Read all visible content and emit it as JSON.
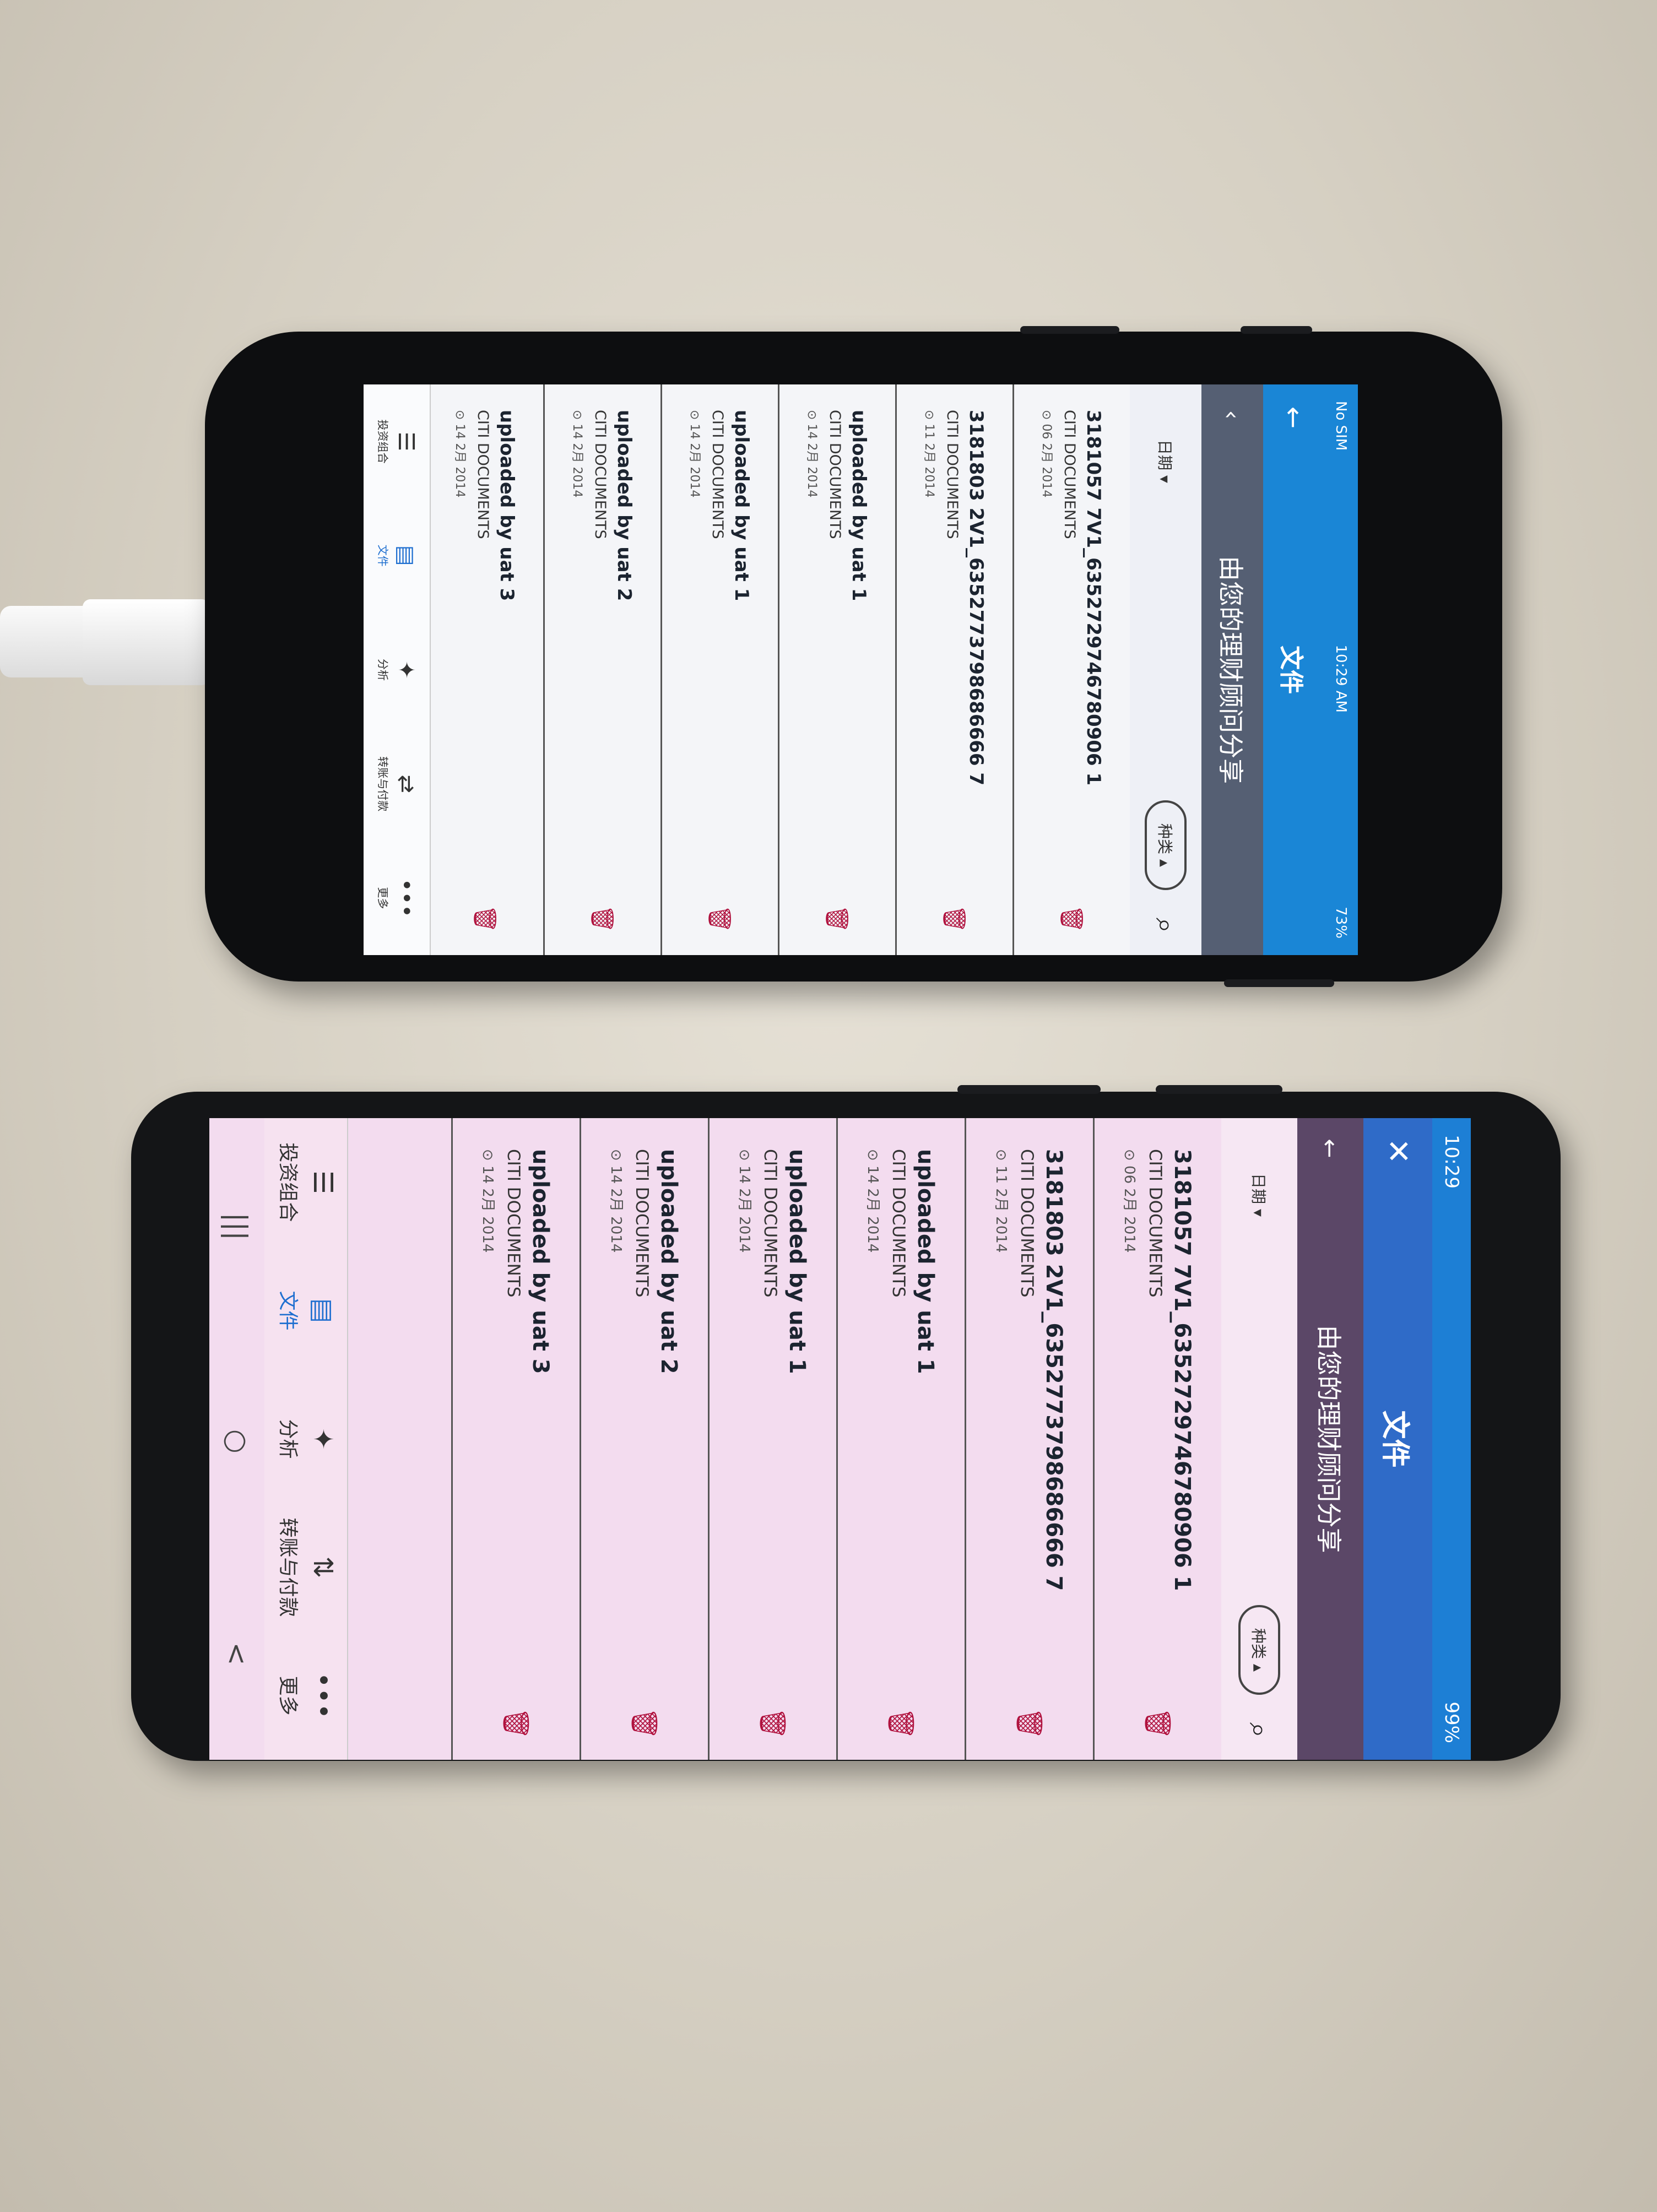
{
  "top_phone": {
    "status": {
      "carrier": "No SIM",
      "time": "10:29 AM",
      "battery": "73%"
    },
    "appbar": {
      "title": "文件"
    },
    "subbar": {
      "text": "由您的理财顾问分享"
    },
    "filters": {
      "date": "日期 ▾",
      "type": "种类 ▴"
    },
    "files": [
      {
        "name": "3181057 7V1_6352729746780906 1",
        "source": "CITI DOCUMENTS",
        "date": "⊙ 06 2月 2014"
      },
      {
        "name": "3181803 2V1_6352773798686666 7",
        "source": "CITI DOCUMENTS",
        "date": "⊙ 11 2月 2014"
      },
      {
        "name": "uploaded by uat 1",
        "source": "CITI DOCUMENTS",
        "date": "⊙ 14 2月 2014"
      },
      {
        "name": "uploaded by uat 1",
        "source": "CITI DOCUMENTS",
        "date": "⊙ 14 2月 2014"
      },
      {
        "name": "uploaded by uat 2",
        "source": "CITI DOCUMENTS",
        "date": "⊙ 14 2月 2014"
      },
      {
        "name": "uploaded by uat 3",
        "source": "CITI DOCUMENTS",
        "date": "⊙ 14 2月 2014"
      }
    ],
    "tabs": [
      {
        "label": "投资组合",
        "icon": "portfolio-icon",
        "glyph": "☰"
      },
      {
        "label": "文件",
        "icon": "document-icon",
        "glyph": "▤"
      },
      {
        "label": "分析",
        "icon": "lightbulb-icon",
        "glyph": "✦"
      },
      {
        "label": "转账与付款",
        "icon": "transfer-icon",
        "glyph": "⇄"
      },
      {
        "label": "更多",
        "icon": "more-icon",
        "glyph": "•••"
      }
    ]
  },
  "bottom_phone": {
    "status": {
      "time": "10:29",
      "battery": "99%"
    },
    "appbar": {
      "title": "文件"
    },
    "subbar": {
      "text": "由您的理财顾问分享"
    },
    "filters": {
      "date": "日期 ▾",
      "type": "种类 ▴"
    },
    "files": [
      {
        "name": "3181057 7V1_6352729746780906 1",
        "source": "CITI DOCUMENTS",
        "date": "⊙ 06 2月 2014"
      },
      {
        "name": "3181803 2V1_6352773798686666 7",
        "source": "CITI DOCUMENTS",
        "date": "⊙ 11 2月 2014"
      },
      {
        "name": "uploaded by uat 1",
        "source": "CITI DOCUMENTS",
        "date": "⊙ 14 2月 2014"
      },
      {
        "name": "uploaded by uat 1",
        "source": "CITI DOCUMENTS",
        "date": "⊙ 14 2月 2014"
      },
      {
        "name": "uploaded by uat 2",
        "source": "CITI DOCUMENTS",
        "date": "⊙ 14 2月 2014"
      },
      {
        "name": "uploaded by uat 3",
        "source": "CITI DOCUMENTS",
        "date": "⊙ 14 2月 2014"
      }
    ],
    "tabs": [
      {
        "label": "投资组合",
        "icon": "portfolio-icon",
        "glyph": "☰"
      },
      {
        "label": "文件",
        "icon": "document-icon",
        "glyph": "▤"
      },
      {
        "label": "分析",
        "icon": "lightbulb-icon",
        "glyph": "✦"
      },
      {
        "label": "转账与付款",
        "icon": "transfer-icon",
        "glyph": "⇅"
      },
      {
        "label": "更多",
        "icon": "more-icon",
        "glyph": "•••"
      }
    ],
    "system_nav": {
      "recents": "|||",
      "home": "○",
      "back": "<"
    }
  }
}
